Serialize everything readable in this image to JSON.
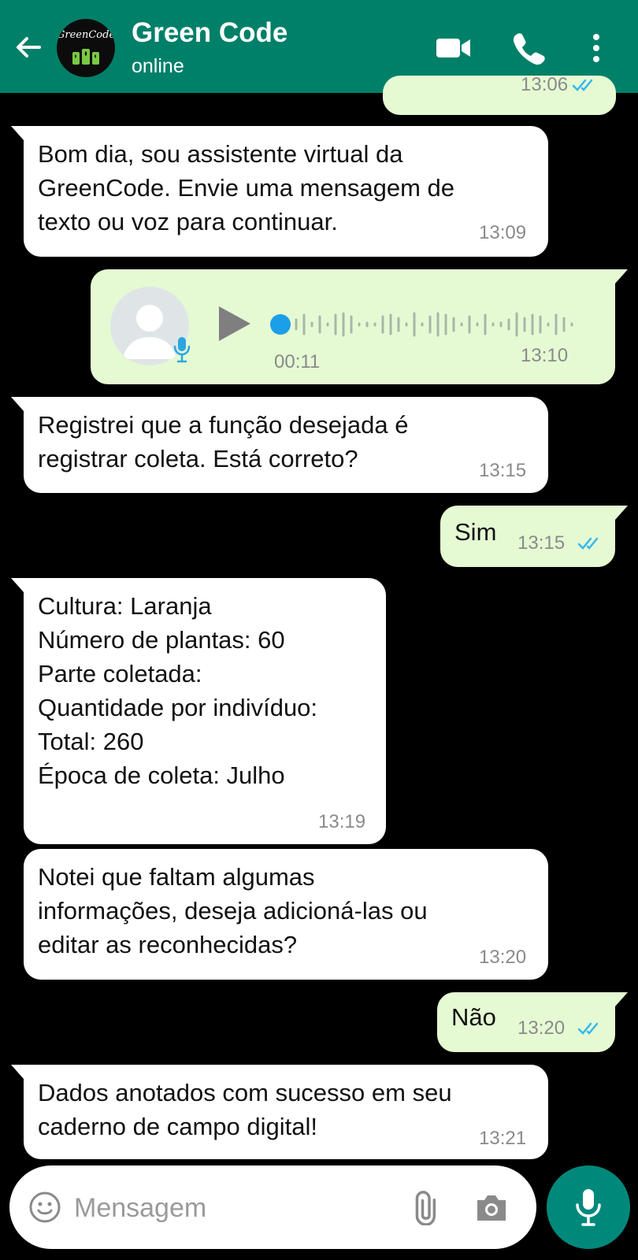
{
  "header": {
    "contact_name": "Green Code",
    "status": "online",
    "avatar_text": "GreenCode",
    "brand_color": "#008069"
  },
  "messages": [
    {
      "direction": "out",
      "text": "",
      "time": "13:06",
      "status": "read"
    },
    {
      "direction": "in",
      "text": "Bom dia, sou assistente virtual da\nGreenCode. Envie uma mensagem de\ntexto ou voz para continuar.",
      "time": "13:09"
    },
    {
      "direction": "out",
      "type": "voice",
      "duration": "00:11",
      "time": "13:10"
    },
    {
      "direction": "in",
      "text": "Registrei que a função desejada é\nregistrar coleta. Está correto?",
      "time": "13:15"
    },
    {
      "direction": "out",
      "text": "Sim",
      "time": "13:15",
      "status": "read"
    },
    {
      "direction": "in",
      "text": "Cultura: Laranja\nNúmero de plantas: 60\nParte coletada:\nQuantidade por indivíduo:\nTotal: 260\nÉpoca de coleta: Julho",
      "time": "13:19"
    },
    {
      "direction": "in",
      "text": "Notei que faltam algumas\ninformações,  deseja adicioná-las ou\neditar as reconhecidas?",
      "time": "13:20"
    },
    {
      "direction": "out",
      "text": "Não",
      "time": "13:20",
      "status": "read"
    },
    {
      "direction": "in",
      "text": "Dados anotados com sucesso em seu\ncaderno de campo digital!",
      "time": "13:21"
    }
  ],
  "input": {
    "placeholder": "Mensagem",
    "value": ""
  },
  "icons": {
    "back": "arrow-left-icon",
    "video": "video-camera-icon",
    "call": "phone-icon",
    "menu": "more-vert-icon",
    "emoji": "emoji-icon",
    "attach": "paperclip-icon",
    "camera": "camera-icon",
    "mic": "microphone-icon"
  },
  "colors": {
    "incoming_bubble": "#ffffff",
    "outgoing_bubble": "#e5fad3",
    "read_ticks": "#34b7f1",
    "mic_button": "#00897b"
  }
}
